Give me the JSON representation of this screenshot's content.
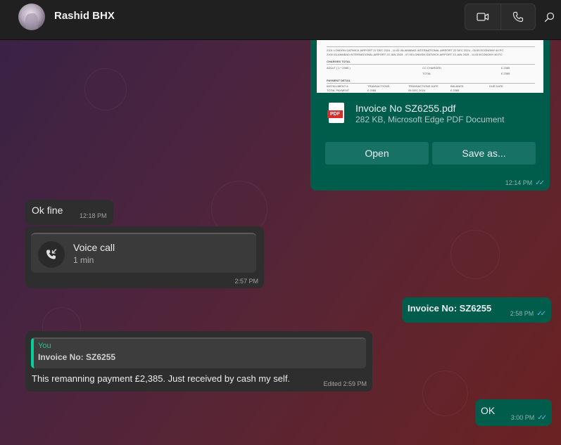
{
  "header": {
    "contact_name": "Rashid BHX",
    "video_call_icon": "video-camera-icon",
    "voice_call_icon": "phone-icon",
    "search_icon": "search-icon"
  },
  "messages": {
    "document": {
      "preview": {
        "row1": "2101    LONDON GATWICK AIRPORT        22 DEC 2024 - 11:00   ISLAMABAD INTERNATIONAL AIRPORT     22 DEC 2024 - 05:55  ECONOMY       60 PC",
        "row2": "2100    ISLAMABAD INTERNATIONAL AIRPORT   23 JAN 2025 - 07:05   LONDON GATWICK AIRPORT      23 JAN 2025 - 11:05  ECONOMY       60 PC",
        "charges": "CHARGES TOTAL",
        "adult": "ADULT ( 1 * 2385 )",
        "total": "TOTAL",
        "cc": "CC CHARGED",
        "amt1": "£ 2385",
        "amt2": "£ 2385",
        "payment": "PAYMENT DETAIL",
        "installment": "INSTALLMENT #",
        "transactions": "TRANSACTIONS",
        "tdate": "TRANSACTIONS DATE",
        "balance": "BALANCE",
        "due": "DUE DATE",
        "total_payment": "TOTAL PAYMENT",
        "p1": "£ 2385",
        "p2": "05 DEC 2024",
        "p3": "£ 2385"
      },
      "file_name": "Invoice No SZ6255.pdf",
      "file_info": "282 KB, Microsoft Edge PDF Document",
      "open_label": "Open",
      "save_label": "Save as...",
      "time": "12:14 PM",
      "ticks": "✓✓"
    },
    "ok_fine": {
      "text": "Ok fine",
      "time": "12:18 PM"
    },
    "voice_call": {
      "title": "Voice call",
      "duration": "1 min",
      "time": "2:57 PM",
      "icon": "missed-call-arrow-icon"
    },
    "invoice_msg": {
      "text": "Invoice No: SZ6255",
      "time": "2:58 PM",
      "ticks": "✓✓"
    },
    "reply": {
      "quote_author": "You",
      "quote_text": "Invoice No: SZ6255",
      "text": "This remanning payment £2,385. Just received by cash my self.",
      "time": "Edited 2:59 PM"
    },
    "ok": {
      "text": "OK",
      "time": "3:00 PM",
      "ticks": "✓✓"
    }
  },
  "colors": {
    "outgoing_bubble": "#005c4b",
    "incoming_bubble": "#2e2e2e",
    "accent": "#06cf9c",
    "read_ticks": "#53bdeb"
  }
}
